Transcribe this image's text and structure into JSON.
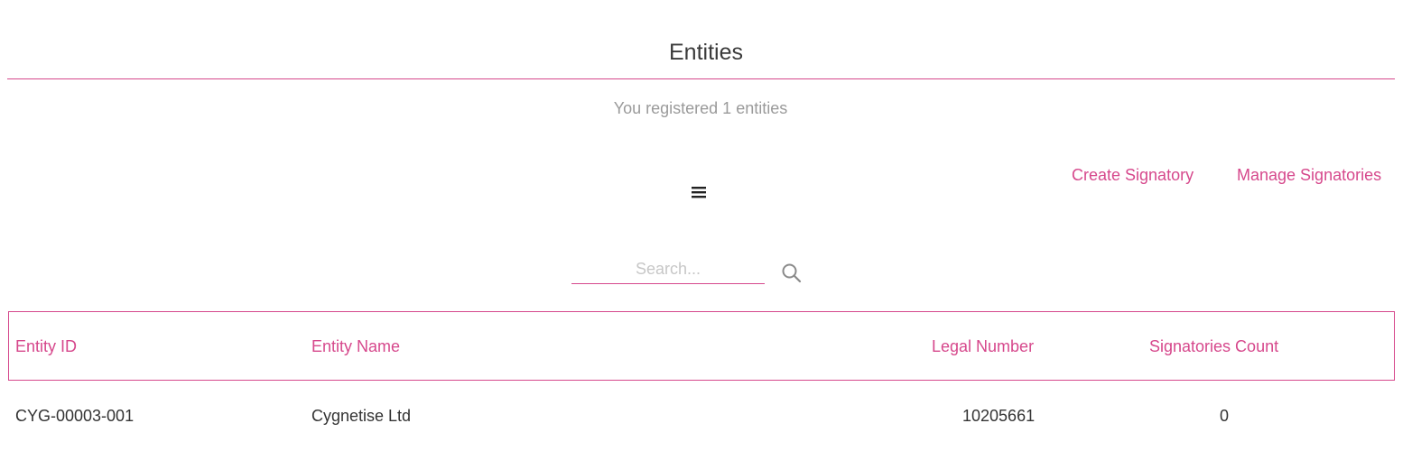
{
  "header": {
    "title": "Entities",
    "subtitle": "You registered 1 entities"
  },
  "actions": {
    "create_signatory": "Create Signatory",
    "manage_signatories": "Manage Signatories"
  },
  "menu": {
    "icon": "hamburger-menu-icon"
  },
  "search": {
    "placeholder": "Search...",
    "value": "",
    "icon": "search-icon"
  },
  "table": {
    "columns": [
      "Entity ID",
      "Entity Name",
      "Legal Number",
      "Signatories Count"
    ],
    "rows": [
      {
        "entity_id": "CYG-00003-001",
        "entity_name": "Cygnetise Ltd",
        "legal_number": "10205661",
        "signatories_count": "0"
      }
    ]
  },
  "colors": {
    "accent": "#d6488c",
    "title_text": "#3a3a3a",
    "muted_text": "#9a9a9a",
    "body_text": "#333333"
  }
}
